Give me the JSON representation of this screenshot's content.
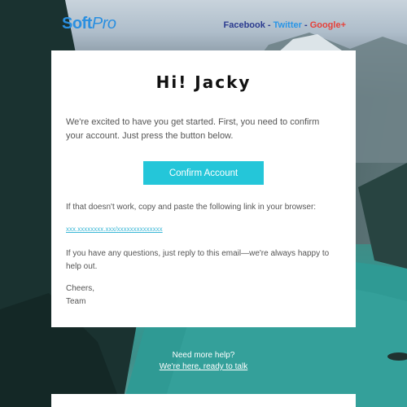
{
  "header": {
    "logo_main": "Soft",
    "logo_accent": "Pro",
    "social": {
      "facebook": "Facebook",
      "twitter": "Twitter",
      "google": "Google+",
      "separator": " - "
    }
  },
  "email": {
    "greeting": "Hi! Jacky",
    "intro": "We're excited to have you get started. First, you need to confirm your account. Just press the button below.",
    "confirm_button": "Confirm Account",
    "fallback_text": "If that doesn't work, copy and paste the following link in your browser:",
    "link_text": "xxx.xxxxxxxx.xxx/xxxxxxxxxxxxxx",
    "questions_text": "If you have any questions, just reply to this email—we're always happy to help out.",
    "signoff": "Cheers,",
    "signature": "Team"
  },
  "footer": {
    "help_title": "Need more help?",
    "help_link": "We're here, ready to talk"
  },
  "colors": {
    "brand": "#2a8fe0",
    "button": "#24c6d9",
    "link": "#3bb7d6"
  }
}
